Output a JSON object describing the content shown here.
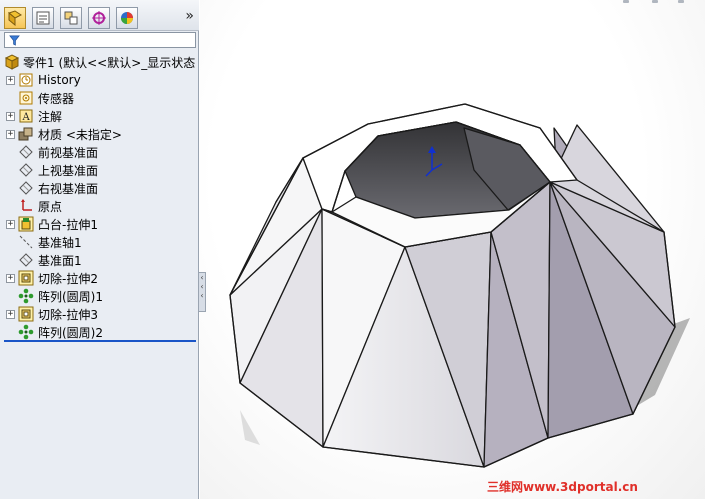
{
  "panel": {
    "tabs": [
      {
        "name": "feature-manager-tab",
        "icon": "feature-tree-icon"
      },
      {
        "name": "property-manager-tab",
        "icon": "property-icon"
      },
      {
        "name": "configuration-manager-tab",
        "icon": "configuration-icon"
      },
      {
        "name": "dimxpert-manager-tab",
        "icon": "dimxpert-icon"
      },
      {
        "name": "display-manager-tab",
        "icon": "appearance-icon"
      }
    ],
    "more_label": "»",
    "filter_icon": "filter-icon"
  },
  "tree": {
    "root_label": "零件1 (默认<<默认>_显示状态",
    "items": [
      {
        "label": "History",
        "icon": "history-icon",
        "expandable": true
      },
      {
        "label": "传感器",
        "icon": "sensor-icon",
        "expandable": false
      },
      {
        "label": "注解",
        "icon": "annotation-icon",
        "expandable": true
      },
      {
        "label": "材质 <未指定>",
        "icon": "material-icon",
        "expandable": true
      },
      {
        "label": "前视基准面",
        "icon": "plane-icon",
        "expandable": false
      },
      {
        "label": "上视基准面",
        "icon": "plane-icon",
        "expandable": false
      },
      {
        "label": "右视基准面",
        "icon": "plane-icon",
        "expandable": false
      },
      {
        "label": "原点",
        "icon": "origin-icon",
        "expandable": false
      },
      {
        "label": "凸台-拉伸1",
        "icon": "boss-extrude-icon",
        "expandable": true
      },
      {
        "label": "基准轴1",
        "icon": "axis-icon",
        "expandable": false
      },
      {
        "label": "基准面1",
        "icon": "plane-icon",
        "expandable": false
      },
      {
        "label": "切除-拉伸2",
        "icon": "cut-extrude-icon",
        "expandable": true
      },
      {
        "label": "阵列(圆周)1",
        "icon": "circular-pattern-icon",
        "expandable": false
      },
      {
        "label": "切除-拉伸3",
        "icon": "cut-extrude-icon",
        "expandable": true
      },
      {
        "label": "阵列(圆周)2",
        "icon": "circular-pattern-icon",
        "expandable": false
      }
    ]
  },
  "viewport": {
    "model": "octagonal-pyramid-frustum-part",
    "watermark": "三维网www.3dportal.cn"
  },
  "colors": {
    "panel_bg": "#e9edf3",
    "rollback_bar": "#1a55c7",
    "watermark": "#e0302a"
  }
}
